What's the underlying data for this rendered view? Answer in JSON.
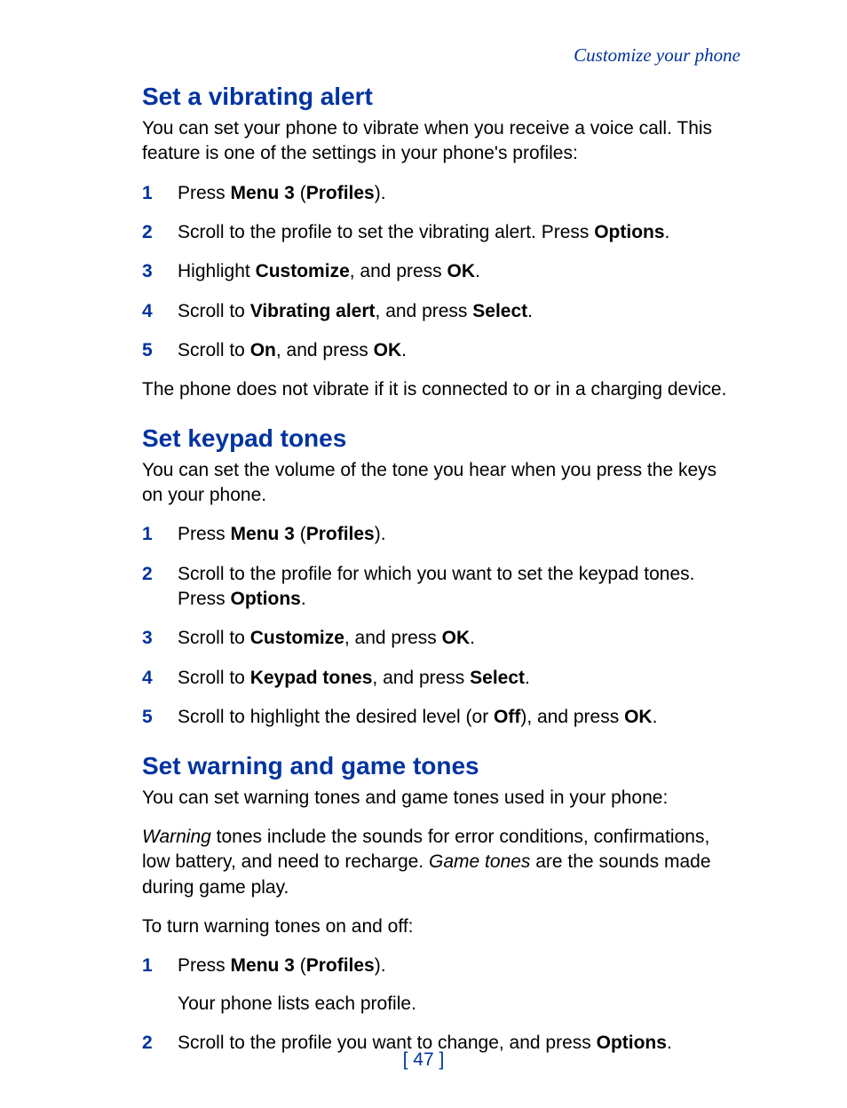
{
  "breadcrumb": "Customize your phone",
  "page_number": "[ 47 ]",
  "sections": [
    {
      "heading": "Set a vibrating alert",
      "intro_parts": [
        {
          "t": "You can set your phone to vibrate when you receive a voice call. This feature is one of the settings in your phone's profiles:"
        }
      ],
      "steps": [
        [
          {
            "t": "Press "
          },
          {
            "t": "Menu 3",
            "b": true
          },
          {
            "t": " ("
          },
          {
            "t": "Profiles",
            "b": true
          },
          {
            "t": ")."
          }
        ],
        [
          {
            "t": "Scroll to the profile to set the vibrating alert. Press "
          },
          {
            "t": "Options",
            "b": true
          },
          {
            "t": "."
          }
        ],
        [
          {
            "t": "Highlight "
          },
          {
            "t": "Customize",
            "b": true
          },
          {
            "t": ", and press "
          },
          {
            "t": "OK",
            "b": true
          },
          {
            "t": "."
          }
        ],
        [
          {
            "t": "Scroll to "
          },
          {
            "t": "Vibrating alert",
            "b": true
          },
          {
            "t": ", and press "
          },
          {
            "t": "Select",
            "b": true
          },
          {
            "t": "."
          }
        ],
        [
          {
            "t": "Scroll to "
          },
          {
            "t": "On",
            "b": true
          },
          {
            "t": ", and press "
          },
          {
            "t": "OK",
            "b": true
          },
          {
            "t": "."
          }
        ]
      ],
      "outro_parts": [
        {
          "t": "The phone does not vibrate if it is connected to or in a charging device."
        }
      ]
    },
    {
      "heading": "Set keypad tones",
      "intro_parts": [
        {
          "t": "You can set the volume of the tone you hear when you press the keys on your phone."
        }
      ],
      "steps": [
        [
          {
            "t": "Press "
          },
          {
            "t": "Menu 3",
            "b": true
          },
          {
            "t": " ("
          },
          {
            "t": "Profiles",
            "b": true
          },
          {
            "t": ")."
          }
        ],
        [
          {
            "t": "Scroll to the profile for which you want to set the keypad tones. Press "
          },
          {
            "t": "Options",
            "b": true
          },
          {
            "t": "."
          }
        ],
        [
          {
            "t": "Scroll to "
          },
          {
            "t": "Customize",
            "b": true
          },
          {
            "t": ", and press "
          },
          {
            "t": "OK",
            "b": true
          },
          {
            "t": "."
          }
        ],
        [
          {
            "t": "Scroll to "
          },
          {
            "t": "Keypad tones",
            "b": true
          },
          {
            "t": ", and press "
          },
          {
            "t": "Select",
            "b": true
          },
          {
            "t": "."
          }
        ],
        [
          {
            "t": "Scroll to highlight the desired level (or "
          },
          {
            "t": "Off",
            "b": true
          },
          {
            "t": "), and press "
          },
          {
            "t": "OK",
            "b": true
          },
          {
            "t": "."
          }
        ]
      ]
    },
    {
      "heading": "Set warning and game tones",
      "intro_parts": [
        {
          "t": "You can set warning tones and game tones used in your phone:"
        }
      ],
      "extra_paragraphs": [
        [
          {
            "t": "Warning",
            "i": true
          },
          {
            "t": " tones include the sounds for error conditions, confirmations, low battery, and need to recharge. "
          },
          {
            "t": "Game tones",
            "i": true
          },
          {
            "t": " are the sounds made during game play."
          }
        ],
        [
          {
            "t": "To turn warning tones on and off:"
          }
        ]
      ],
      "steps": [
        [
          {
            "t": "Press "
          },
          {
            "t": "Menu 3",
            "b": true
          },
          {
            "t": " ("
          },
          {
            "t": "Profiles",
            "b": true
          },
          {
            "t": ")."
          },
          {
            "sub": true,
            "t": "Your phone lists each profile."
          }
        ],
        [
          {
            "t": "Scroll to the profile you want to change, and press "
          },
          {
            "t": "Options",
            "b": true
          },
          {
            "t": "."
          }
        ]
      ]
    }
  ]
}
